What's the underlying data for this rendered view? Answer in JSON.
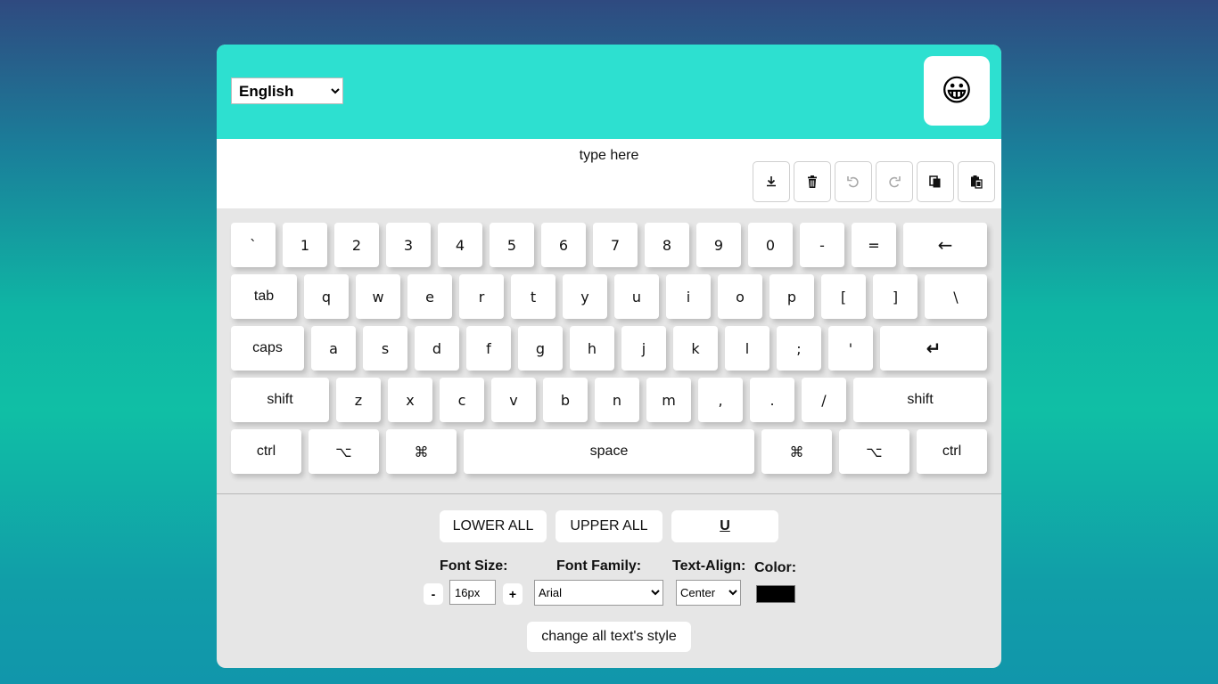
{
  "header": {
    "language_selected": "English",
    "emoji": "😀"
  },
  "editor": {
    "text": "type here",
    "tools": [
      {
        "name": "download-icon"
      },
      {
        "name": "trash-icon"
      },
      {
        "name": "undo-icon"
      },
      {
        "name": "redo-icon"
      },
      {
        "name": "copy-icon"
      },
      {
        "name": "paste-icon"
      }
    ]
  },
  "keyboard": {
    "rows": [
      [
        "`",
        "1",
        "2",
        "3",
        "4",
        "5",
        "6",
        "7",
        "8",
        "9",
        "0",
        "-",
        "=",
        "←"
      ],
      [
        "tab",
        "q",
        "w",
        "e",
        "r",
        "t",
        "y",
        "u",
        "i",
        "o",
        "p",
        "[",
        "]",
        "\\"
      ],
      [
        "caps",
        "a",
        "s",
        "d",
        "f",
        "g",
        "h",
        "j",
        "k",
        "l",
        ";",
        "'",
        "↵"
      ],
      [
        "shift",
        "z",
        "x",
        "c",
        "v",
        "b",
        "n",
        "m",
        ",",
        ".",
        "/",
        "shift"
      ],
      [
        "ctrl",
        "⌥",
        "⌘",
        "space",
        "⌘",
        "⌥",
        "ctrl"
      ]
    ]
  },
  "controls": {
    "lower_all": "LOWER ALL",
    "upper_all": "UPPER ALL",
    "underline": "U",
    "font_size_label": "Font Size:",
    "font_size_minus": "-",
    "font_size_value": "16px",
    "font_size_plus": "+",
    "font_family_label": "Font Family:",
    "font_family_selected": "Arial",
    "text_align_label": "Text-Align:",
    "text_align_selected": "Center",
    "color_label": "Color:",
    "color_value": "#000000",
    "change_all": "change all text's style"
  }
}
